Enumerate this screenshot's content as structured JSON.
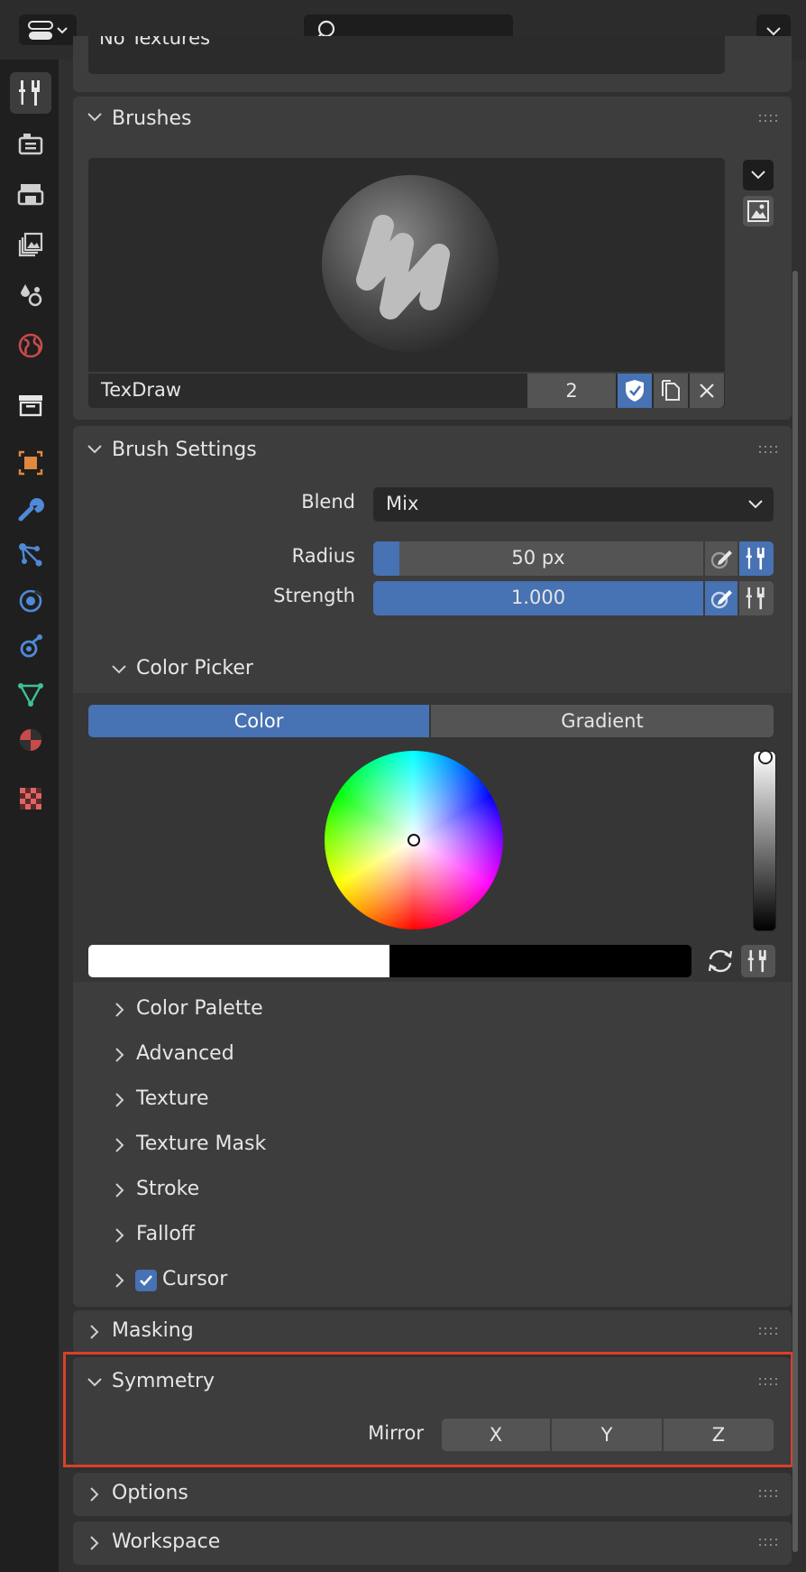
{
  "header": {
    "editor_type_icon": "editor-type-icon",
    "search_placeholder": "",
    "options_icon": "chevron-down-icon"
  },
  "tabs": [
    {
      "name": "tool",
      "icon": "tool-icon",
      "active": true
    },
    {
      "name": "render",
      "icon": "render-icon"
    },
    {
      "name": "output",
      "icon": "output-icon"
    },
    {
      "name": "view-layer",
      "icon": "view-layer-icon"
    },
    {
      "name": "scene",
      "icon": "scene-icon"
    },
    {
      "name": "world",
      "icon": "world-icon"
    },
    {
      "name": "collection",
      "icon": "collection-icon"
    },
    {
      "name": "object",
      "icon": "object-icon"
    },
    {
      "name": "modifiers",
      "icon": "wrench-icon"
    },
    {
      "name": "particles",
      "icon": "particles-icon"
    },
    {
      "name": "physics",
      "icon": "physics-icon"
    },
    {
      "name": "constraints",
      "icon": "constraints-icon"
    },
    {
      "name": "data",
      "icon": "mesh-data-icon"
    },
    {
      "name": "material",
      "icon": "material-icon"
    },
    {
      "name": "texture",
      "icon": "texture-icon"
    }
  ],
  "top_partial": {
    "label": "No Textures"
  },
  "brushes": {
    "title": "Brushes",
    "brush_name": "TexDraw",
    "user_count": "2"
  },
  "brush_settings": {
    "title": "Brush Settings",
    "blend_label": "Blend",
    "blend_value": "Mix",
    "radius_label": "Radius",
    "radius_value": "50 px",
    "radius_fill": 0.08,
    "strength_label": "Strength",
    "strength_value": "1.000",
    "strength_fill": 1.0,
    "color_picker": {
      "title": "Color Picker",
      "tab_color": "Color",
      "tab_gradient": "Gradient",
      "primary_color": "#ffffff",
      "secondary_color": "#000000"
    },
    "subpanels": [
      "Color Palette",
      "Advanced",
      "Texture",
      "Texture Mask",
      "Stroke",
      "Falloff"
    ],
    "cursor_label": "Cursor",
    "cursor_checked": true
  },
  "masking": {
    "title": "Masking"
  },
  "symmetry": {
    "title": "Symmetry",
    "mirror_label": "Mirror",
    "axes": [
      "X",
      "Y",
      "Z"
    ]
  },
  "options": {
    "title": "Options"
  },
  "workspace": {
    "title": "Workspace"
  },
  "colors": {
    "accent": "#4772b3",
    "highlight_box": "#d9402a",
    "panel_bg": "#3d3d3d",
    "field_bg": "#545454"
  }
}
